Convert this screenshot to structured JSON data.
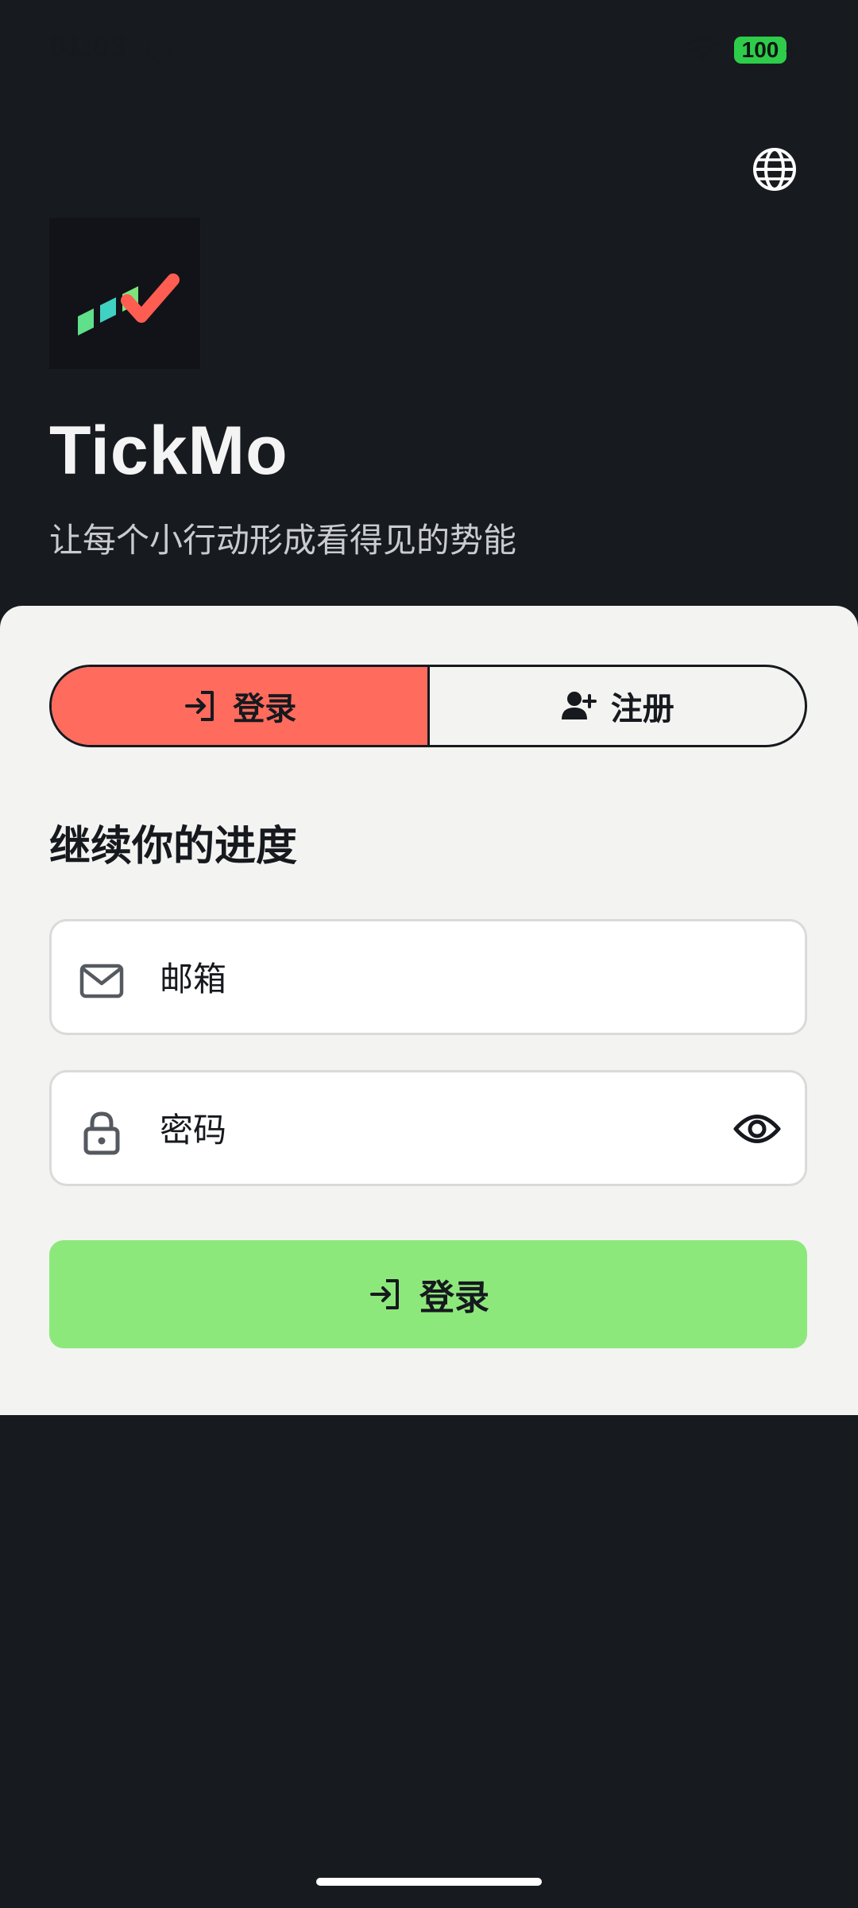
{
  "status_bar": {
    "time": "01:03",
    "battery": "100"
  },
  "icons": {
    "language": "globe-icon",
    "email": "mail-icon",
    "password": "lock-icon",
    "visibility": "eye-icon",
    "login": "login-arrow-icon",
    "register": "add-user-icon"
  },
  "brand": {
    "name": "TickMo",
    "tagline": "让每个小行动形成看得见的势能"
  },
  "tabs": [
    {
      "label": "登录",
      "active": true
    },
    {
      "label": "注册",
      "active": false
    }
  ],
  "form": {
    "title": "继续你的进度",
    "email_placeholder": "邮箱",
    "email_value": "",
    "password_placeholder": "密码",
    "password_value": "",
    "submit_label": "登录"
  },
  "colors": {
    "background": "#171a1f",
    "panel": "#f3f4f1",
    "active_tab": "#ff6b5d",
    "submit": "#8de87c",
    "battery": "#2ecc4a"
  }
}
